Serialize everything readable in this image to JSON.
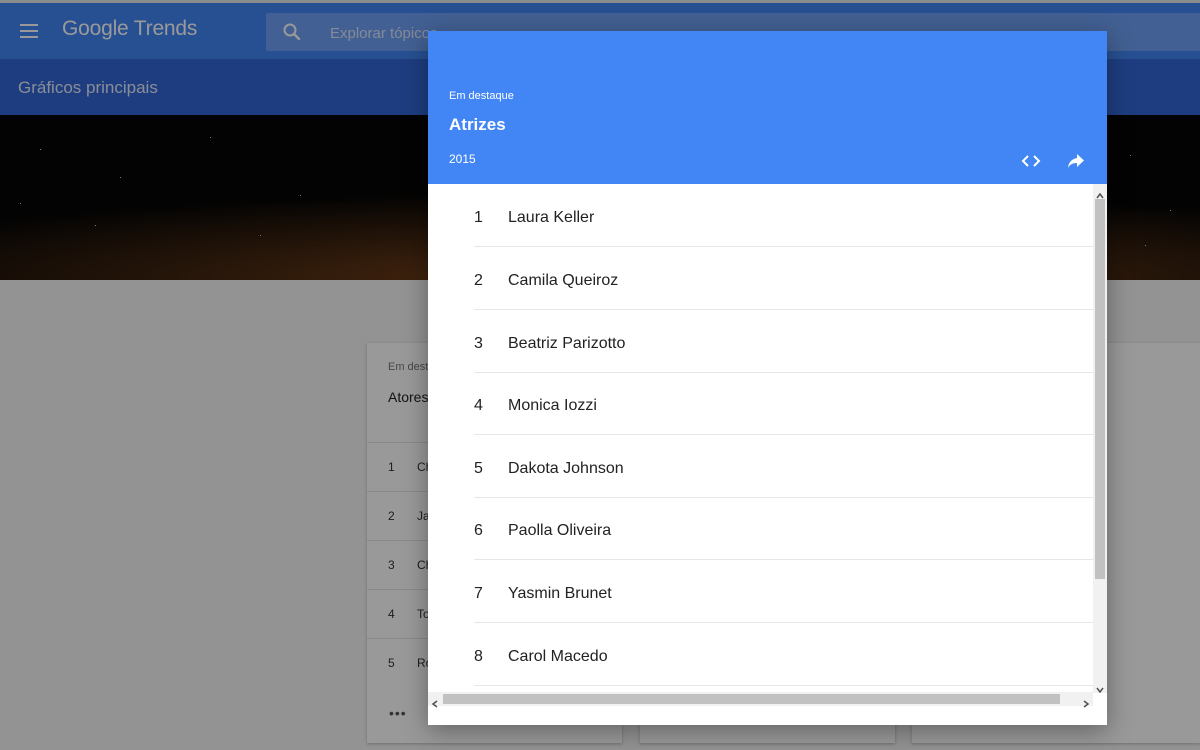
{
  "app": {
    "logo_google": "Google",
    "logo_trends": "Trends",
    "search_placeholder": "Explorar tópicos"
  },
  "subbar": {
    "title": "Gráficos principais"
  },
  "background_card": {
    "eyebrow": "Em destaque",
    "title": "Atores",
    "rows": [
      {
        "rank": "1",
        "label": "Ch"
      },
      {
        "rank": "2",
        "label": "Ja"
      },
      {
        "rank": "3",
        "label": "Ch"
      },
      {
        "rank": "4",
        "label": "To"
      },
      {
        "rank": "5",
        "label": "Ro"
      }
    ],
    "more": "•••"
  },
  "modal": {
    "eyebrow": "Em destaque",
    "title": "Atrizes",
    "year": "2015",
    "items": [
      {
        "rank": "1",
        "name": "Laura Keller"
      },
      {
        "rank": "2",
        "name": "Camila Queiroz"
      },
      {
        "rank": "3",
        "name": "Beatriz Parizotto"
      },
      {
        "rank": "4",
        "name": "Monica Iozzi"
      },
      {
        "rank": "5",
        "name": "Dakota Johnson"
      },
      {
        "rank": "6",
        "name": "Paolla Oliveira"
      },
      {
        "rank": "7",
        "name": "Yasmin Brunet"
      },
      {
        "rank": "8",
        "name": "Carol Macedo"
      }
    ]
  },
  "icons": {
    "menu": "hamburger-menu-icon",
    "search": "search-icon",
    "embed": "code-embed-icon",
    "share": "share-arrow-icon"
  },
  "colors": {
    "primary": "#4285f4",
    "primary_dark": "#3367d6"
  }
}
